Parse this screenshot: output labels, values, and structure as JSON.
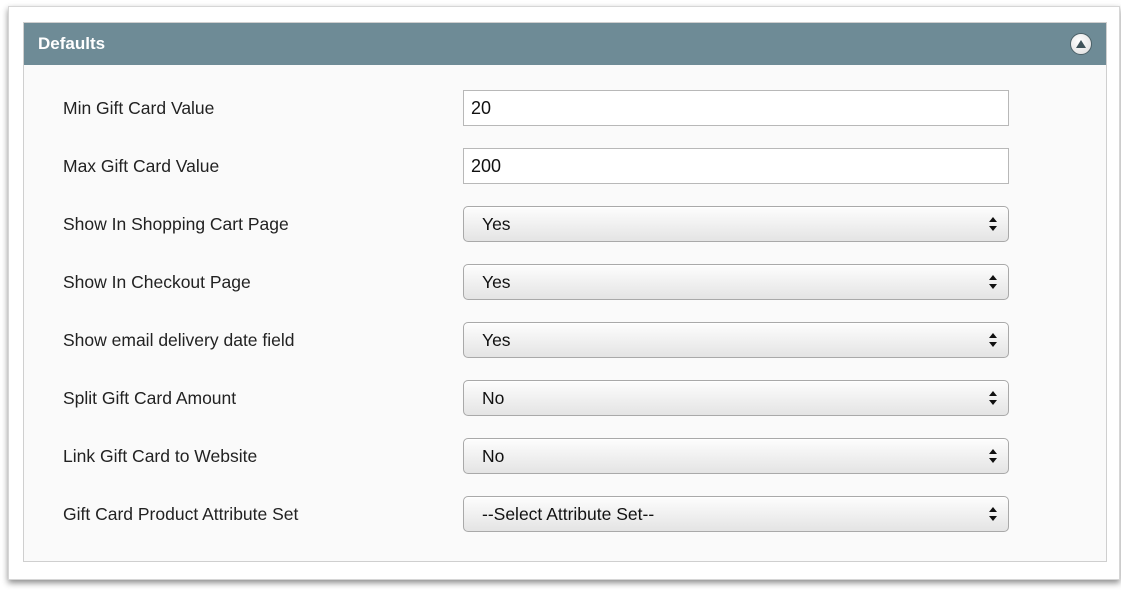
{
  "panel": {
    "title": "Defaults"
  },
  "fields": [
    {
      "label": "Min Gift Card Value",
      "type": "text",
      "value": "20"
    },
    {
      "label": "Max Gift Card Value",
      "type": "text",
      "value": "200"
    },
    {
      "label": "Show In Shopping Cart Page",
      "type": "select",
      "value": "Yes"
    },
    {
      "label": "Show In Checkout Page",
      "type": "select",
      "value": "Yes"
    },
    {
      "label": "Show email delivery date field",
      "type": "select",
      "value": "Yes"
    },
    {
      "label": "Split Gift Card Amount",
      "type": "select",
      "value": "No"
    },
    {
      "label": "Link Gift Card to Website",
      "type": "select",
      "value": "No"
    },
    {
      "label": "Gift Card Product Attribute Set",
      "type": "select",
      "value": "--Select Attribute Set--"
    }
  ],
  "icons": {
    "collapse": "collapse-up-icon",
    "select_arrows": "up-down-arrows-icon"
  },
  "colors": {
    "header_bg": "#6e8b96",
    "header_text": "#ffffff"
  }
}
